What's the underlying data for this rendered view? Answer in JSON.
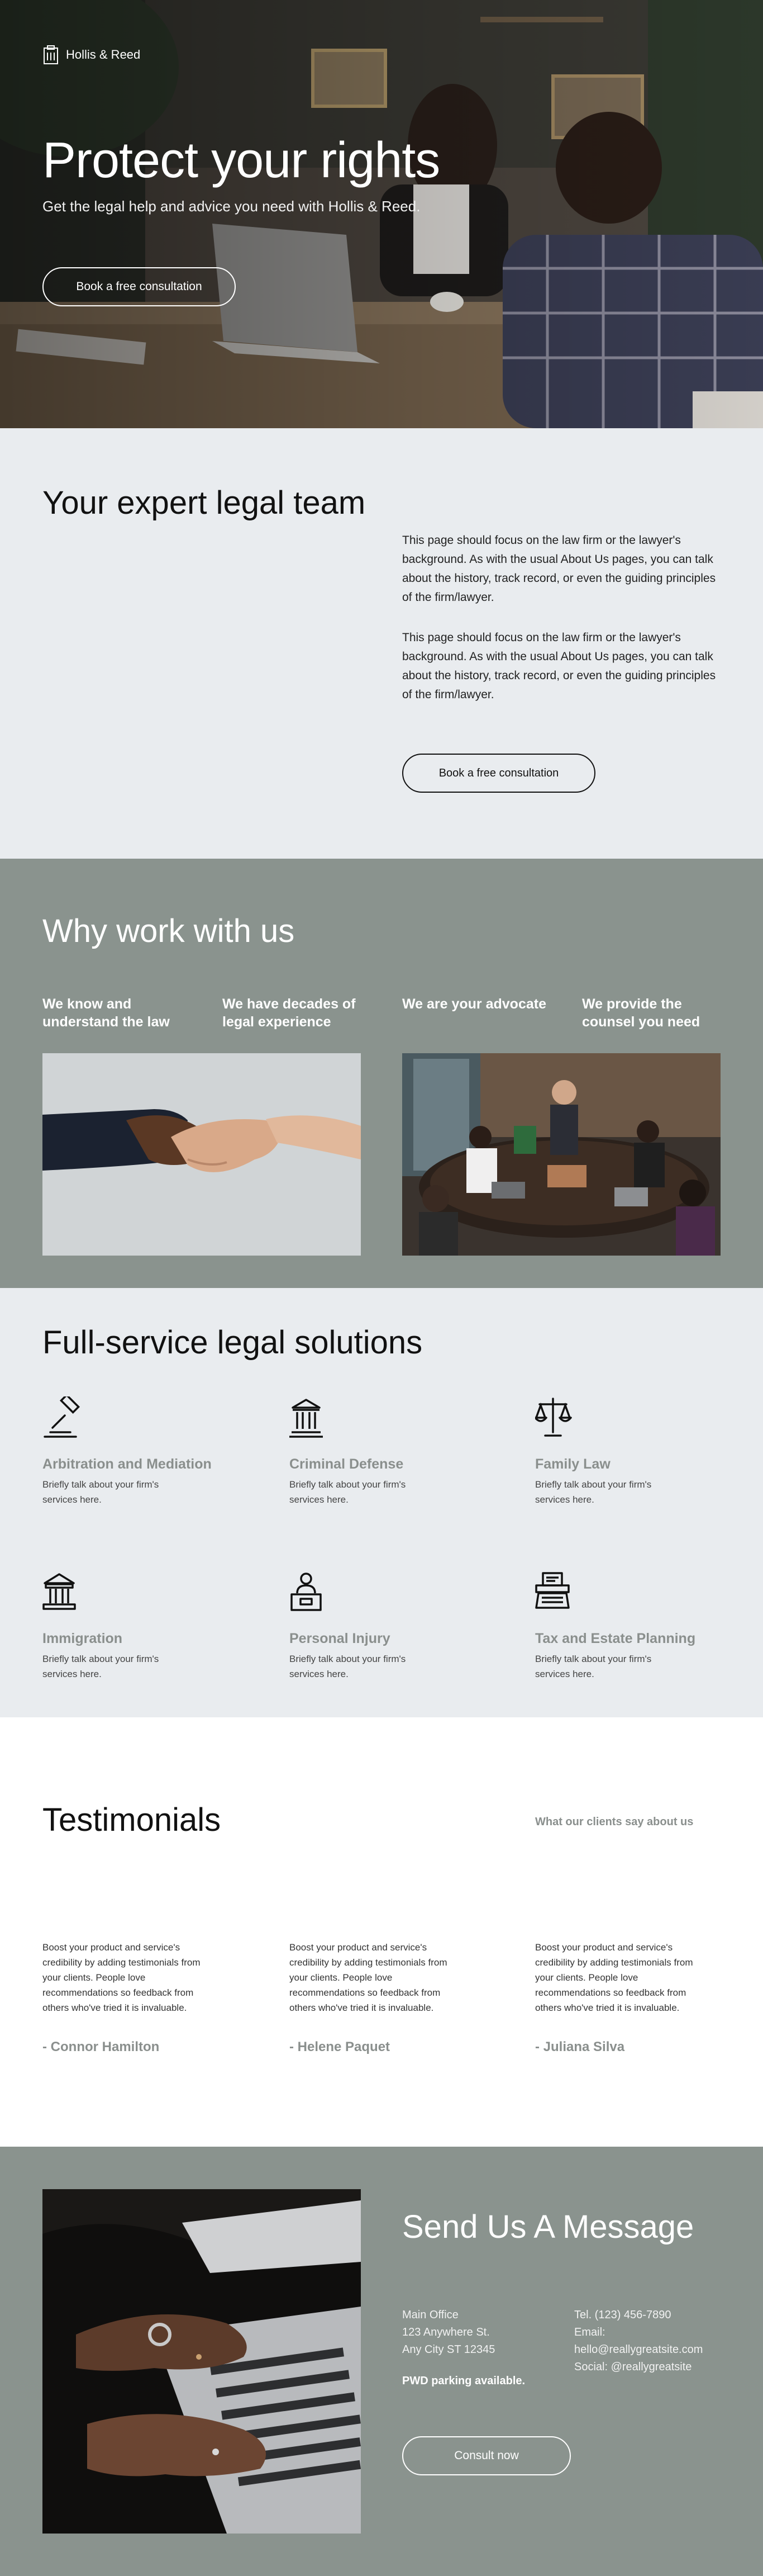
{
  "brand": {
    "name": "Hollis & Reed",
    "logo_icon": "pillar-document-icon"
  },
  "hero": {
    "title": "Protect your rights",
    "subtitle": "Get the legal help and advice you need with Hollis & Reed.",
    "cta_label": "Book a free consultation"
  },
  "team": {
    "heading": "Your expert legal team",
    "paragraphs": [
      "This page should focus on the law firm or the lawyer's background. As with the usual About Us pages, you can talk about the history, track record, or even the guiding principles of the firm/lawyer.",
      "This page should focus on the law firm or the lawyer's background. As with the usual About Us pages, you can talk about the history, track record, or even the guiding principles of the firm/lawyer."
    ],
    "cta_label": "Book a free consultation"
  },
  "why": {
    "heading": "Why work with us",
    "points": [
      "We know and understand the law",
      "We have decades of legal experience",
      "We are your advocate",
      "We provide the counsel you need"
    ]
  },
  "services": {
    "heading": "Full-service legal solutions",
    "items": [
      {
        "title": "Arbitration and Mediation",
        "desc": "Briefly talk about your firm's services here.",
        "icon": "gavel-icon"
      },
      {
        "title": "Criminal Defense",
        "desc": "Briefly talk about your firm's services here.",
        "icon": "courthouse-icon"
      },
      {
        "title": "Family Law",
        "desc": "Briefly talk about your firm's services here.",
        "icon": "scales-icon"
      },
      {
        "title": "Immigration",
        "desc": "Briefly talk about your firm's services here.",
        "icon": "government-building-icon"
      },
      {
        "title": "Personal Injury",
        "desc": "Briefly talk about your firm's services here.",
        "icon": "person-desk-icon"
      },
      {
        "title": "Tax and Estate Planning",
        "desc": "Briefly talk about your firm's services here.",
        "icon": "typewriter-icon"
      }
    ]
  },
  "testimonials": {
    "heading": "Testimonials",
    "tagline": "What our clients say about us",
    "items": [
      {
        "quote": "Boost your product and service's credibility by adding testimonials from your clients. People love recommendations so feedback from others who've tried it is invaluable.",
        "name": "- Connor Hamilton"
      },
      {
        "quote": "Boost your product and service's credibility by adding testimonials from your clients. People love recommendations so feedback from others who've tried it is invaluable.",
        "name": "- Helene Paquet"
      },
      {
        "quote": "Boost your product and service's credibility by adding testimonials from your clients. People love recommendations so feedback from others who've tried it is invaluable.",
        "name": "- Juliana Silva"
      }
    ]
  },
  "contact": {
    "heading": "Send Us A Message",
    "address_lines": [
      "Main Office",
      "123 Anywhere St.",
      "Any City ST 12345"
    ],
    "info_lines": [
      "Tel. (123) 456-7890",
      "Email:",
      "hello@reallygreatsite.com",
      "Social: @reallygreatsite"
    ],
    "parking": "PWD parking available.",
    "cta_label": "Consult now"
  },
  "colors": {
    "section_light": "#e9ecef",
    "section_sage": "#8a938e",
    "muted_title": "#8a8f8d",
    "white": "#ffffff"
  }
}
